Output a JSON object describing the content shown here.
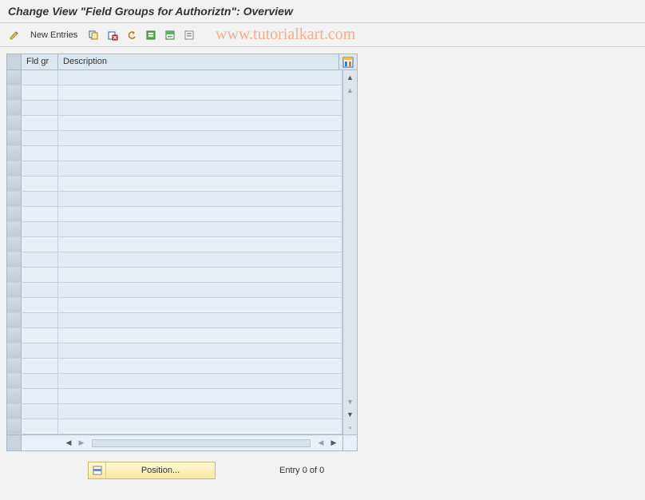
{
  "title": "Change View \"Field Groups for Authoriztn\": Overview",
  "toolbar": {
    "new_entries_label": "New Entries"
  },
  "watermark": "www.tutorialkart.com",
  "table": {
    "headers": {
      "fldgr": "Fld gr",
      "description": "Description"
    },
    "rows_visible": 24
  },
  "footer": {
    "position_label": "Position...",
    "entry_status": "Entry 0 of 0"
  },
  "icons": {
    "edit": "edit-icon",
    "copy": "copy-icon",
    "delete": "delete-icon",
    "undo": "undo-icon",
    "select_all": "select-all-icon",
    "select_block": "select-block-icon",
    "deselect": "deselect-icon",
    "table_config": "table-config-icon"
  }
}
